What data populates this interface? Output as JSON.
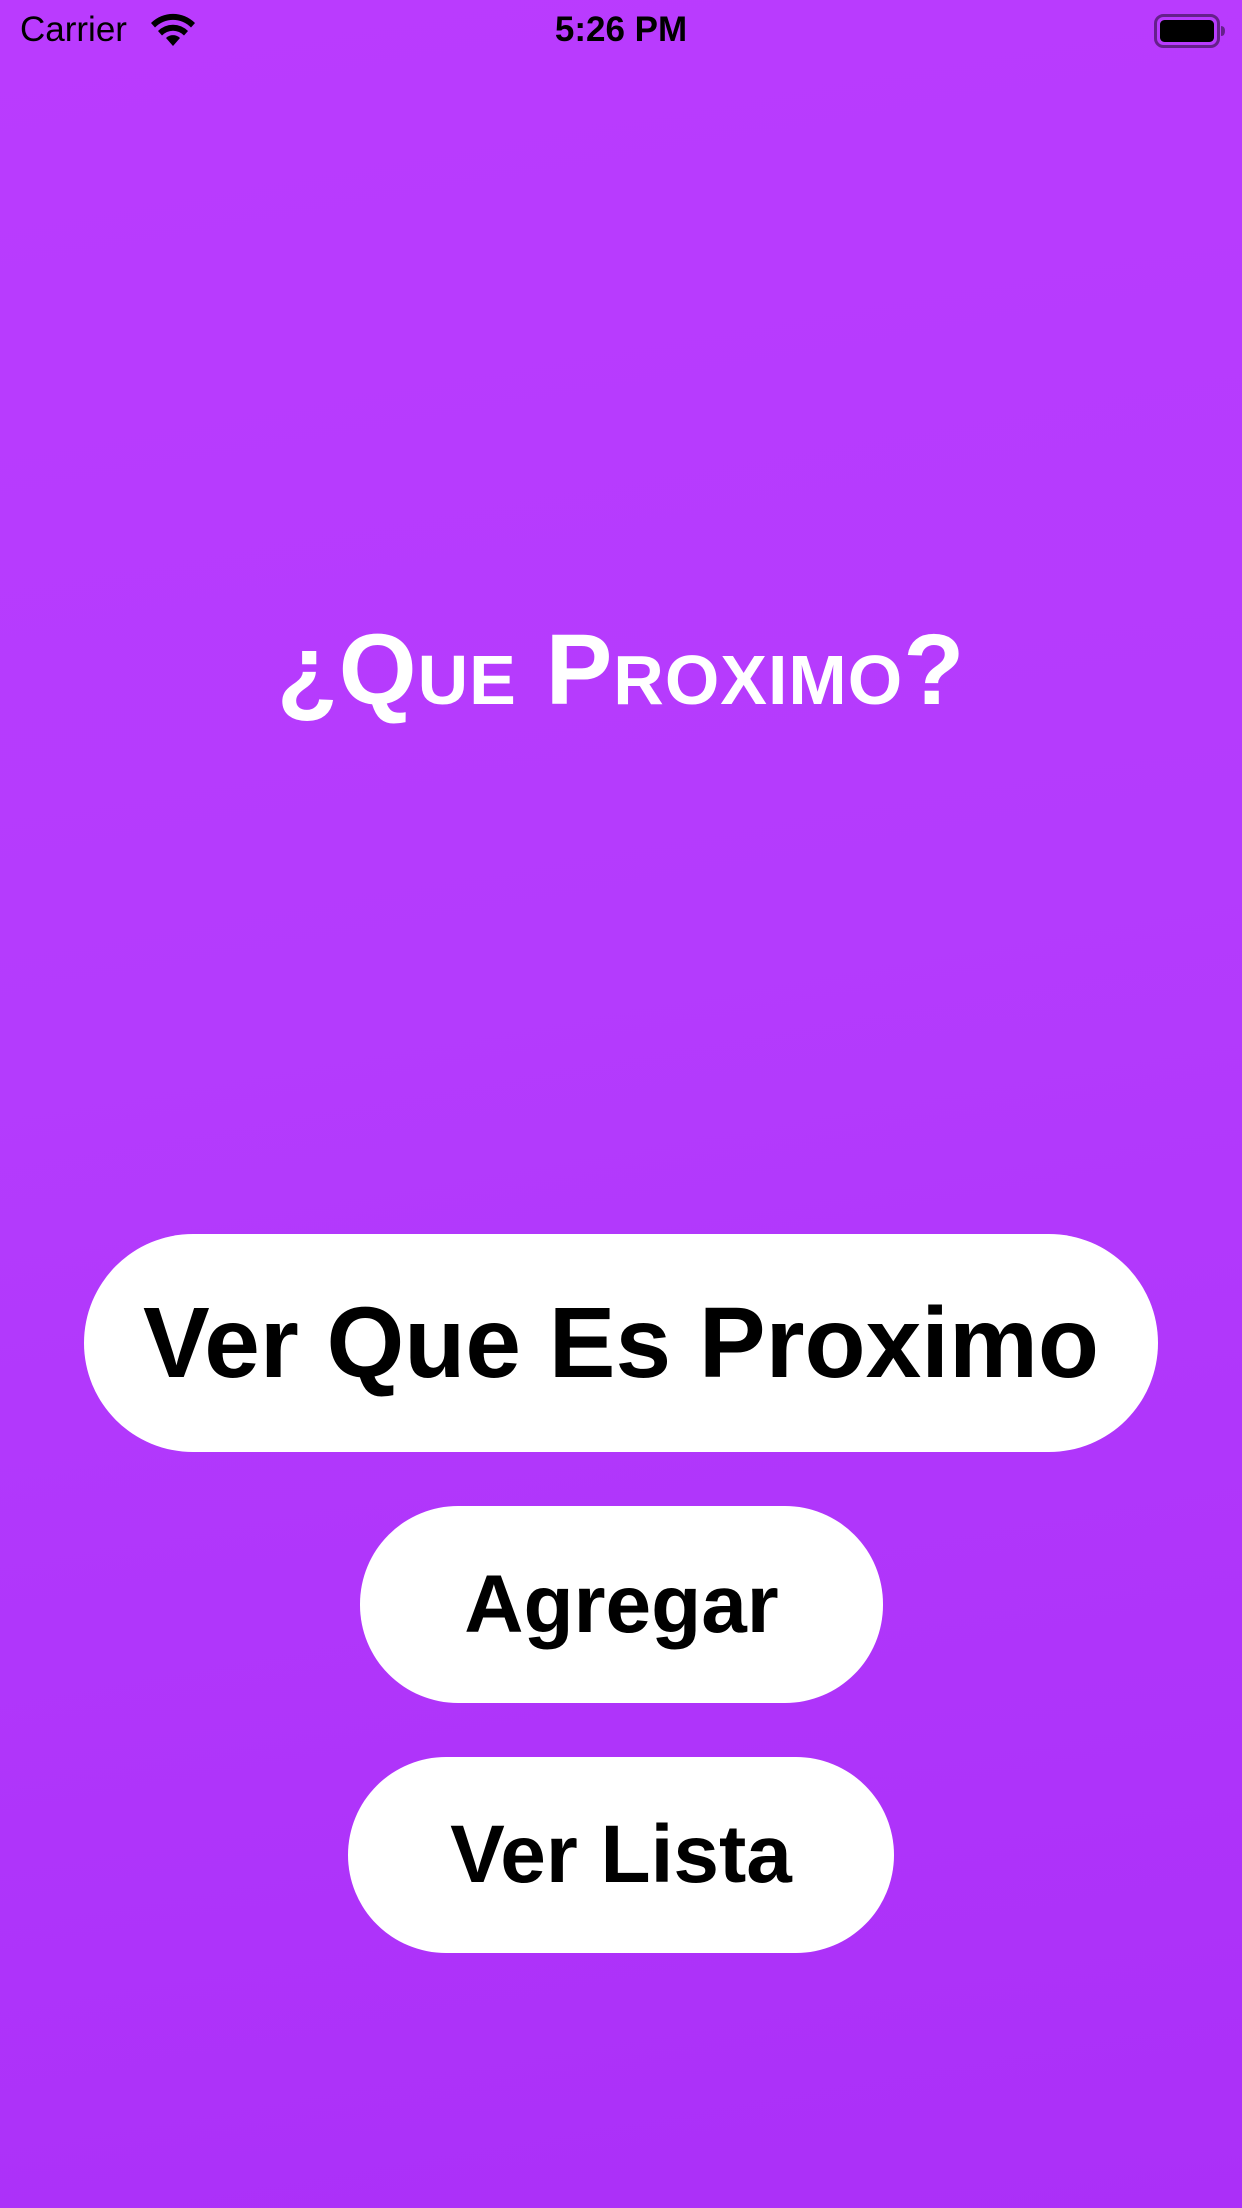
{
  "status_bar": {
    "carrier": "Carrier",
    "time": "5:26 PM",
    "wifi_icon": "wifi-icon",
    "battery_icon": "battery-icon"
  },
  "main": {
    "title": "¿Que Proximo?"
  },
  "buttons": {
    "primary_label": "Ver Que Es Proximo",
    "add_label": "Agregar",
    "list_label": "Ver Lista"
  },
  "colors": {
    "background_top": "#ba3bfe",
    "background_bottom": "#ab2ff8",
    "button_bg": "#ffffff",
    "title_text": "#ffffff",
    "button_text": "#000000"
  }
}
